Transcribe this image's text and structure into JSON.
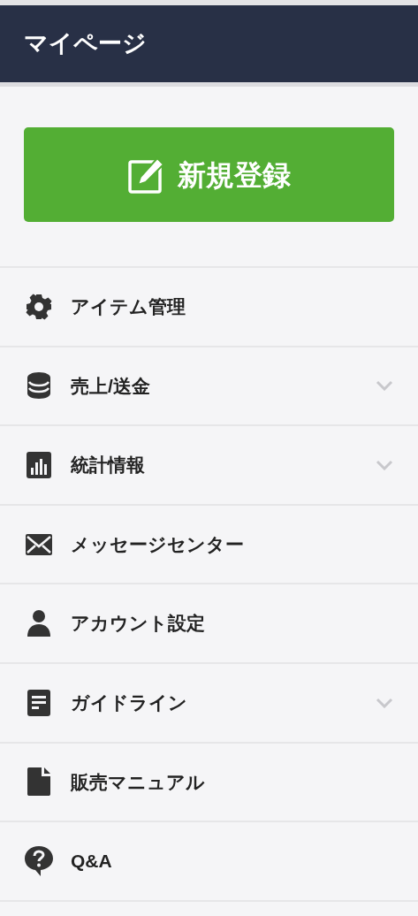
{
  "header": {
    "title": "マイページ"
  },
  "primary_button": {
    "label": "新規登録"
  },
  "menu": [
    {
      "kind": "gear",
      "label": "アイテム管理",
      "expandable": false
    },
    {
      "kind": "coins",
      "label": "売上/送金",
      "expandable": true
    },
    {
      "kind": "chart",
      "label": "統計情報",
      "expandable": true
    },
    {
      "kind": "mail",
      "label": "メッセージセンター",
      "expandable": false
    },
    {
      "kind": "user",
      "label": "アカウント設定",
      "expandable": false
    },
    {
      "kind": "doc",
      "label": "ガイドライン",
      "expandable": true
    },
    {
      "kind": "file",
      "label": "販売マニュアル",
      "expandable": false
    },
    {
      "kind": "question",
      "label": "Q&A",
      "expandable": false
    }
  ]
}
